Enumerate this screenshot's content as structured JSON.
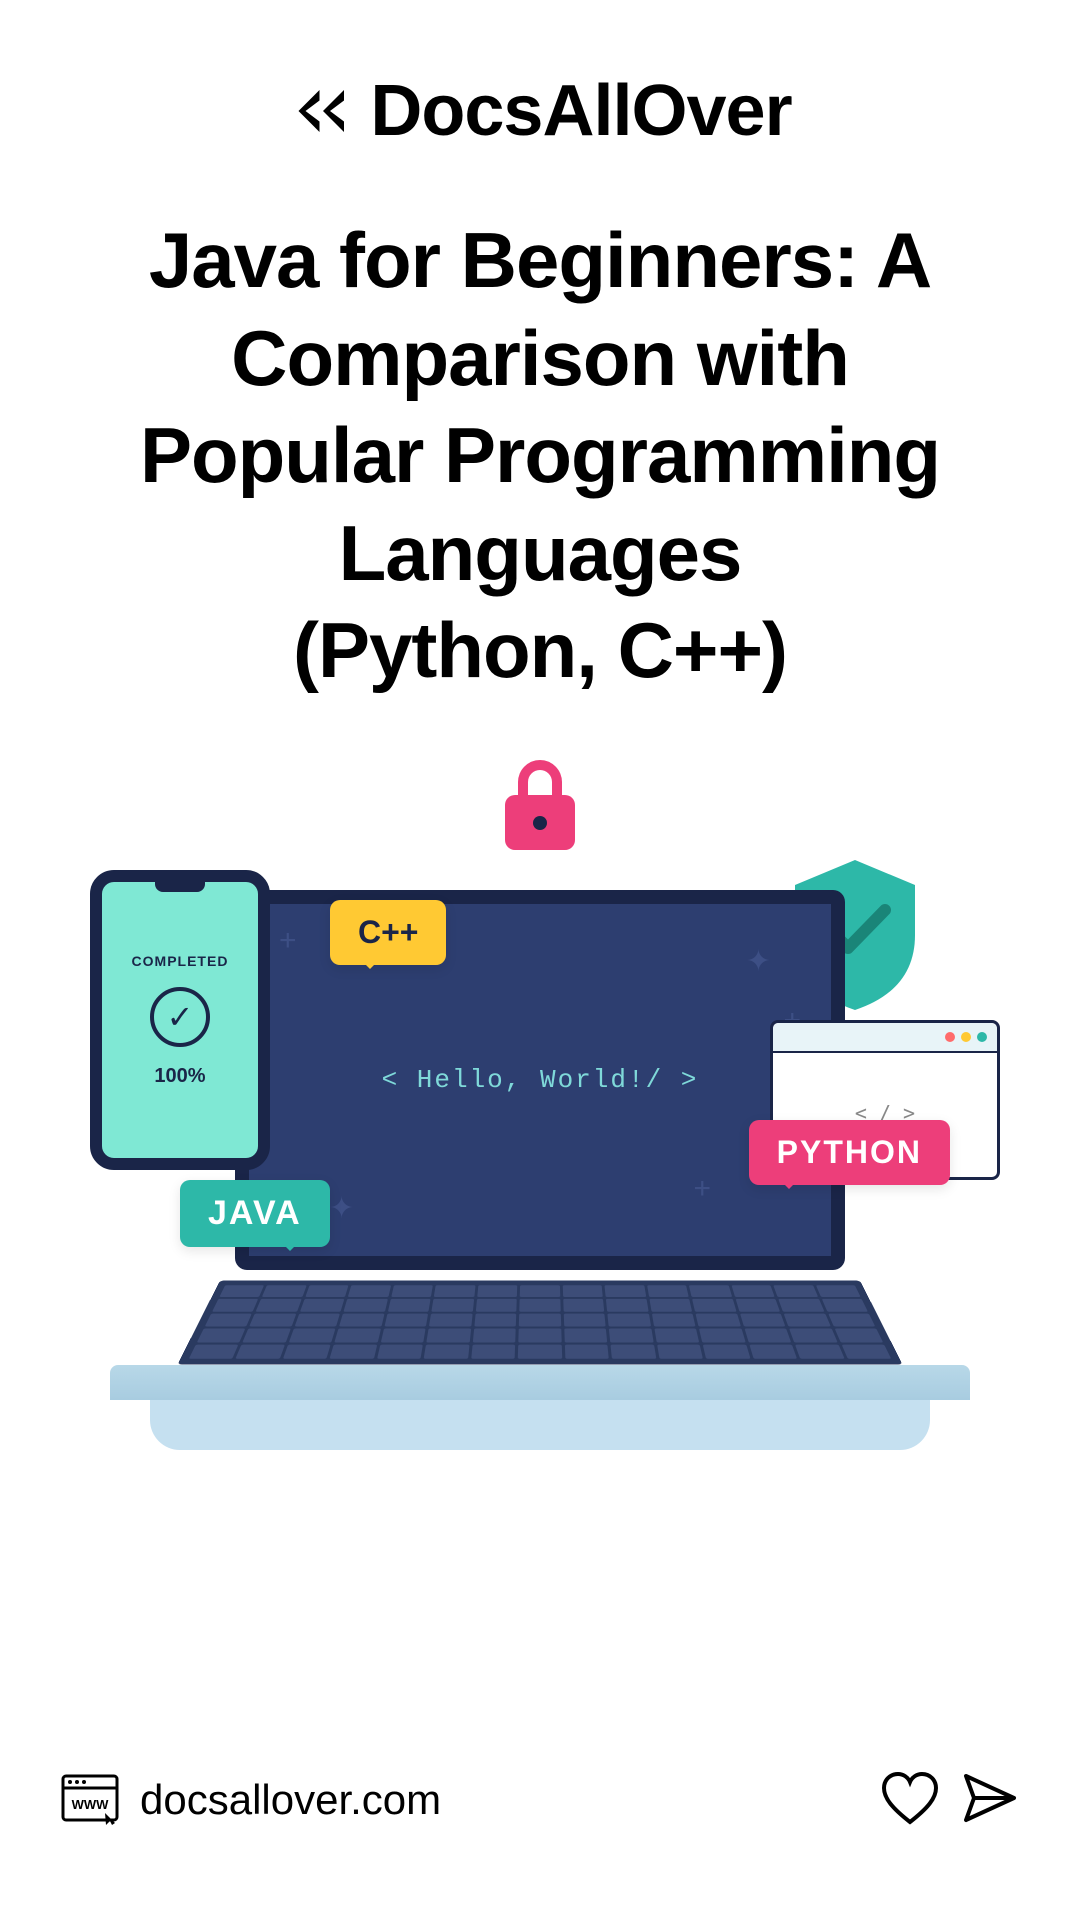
{
  "brand": "DocsAllOver",
  "title_line1": "Java for Beginners: A",
  "title_line2": "Comparison with",
  "title_line3": "Popular Programming",
  "title_line4": "Languages",
  "title_line5": "(Python, C++)",
  "illustration": {
    "screen_text": "< Hello, World!/ >",
    "phone_completed": "COMPLETED",
    "phone_percent": "100%",
    "badge_cpp": "C++",
    "badge_python": "PYTHON",
    "badge_java": "JAVA",
    "browser_code": "< / >"
  },
  "footer": {
    "website": "docsallover.com"
  }
}
